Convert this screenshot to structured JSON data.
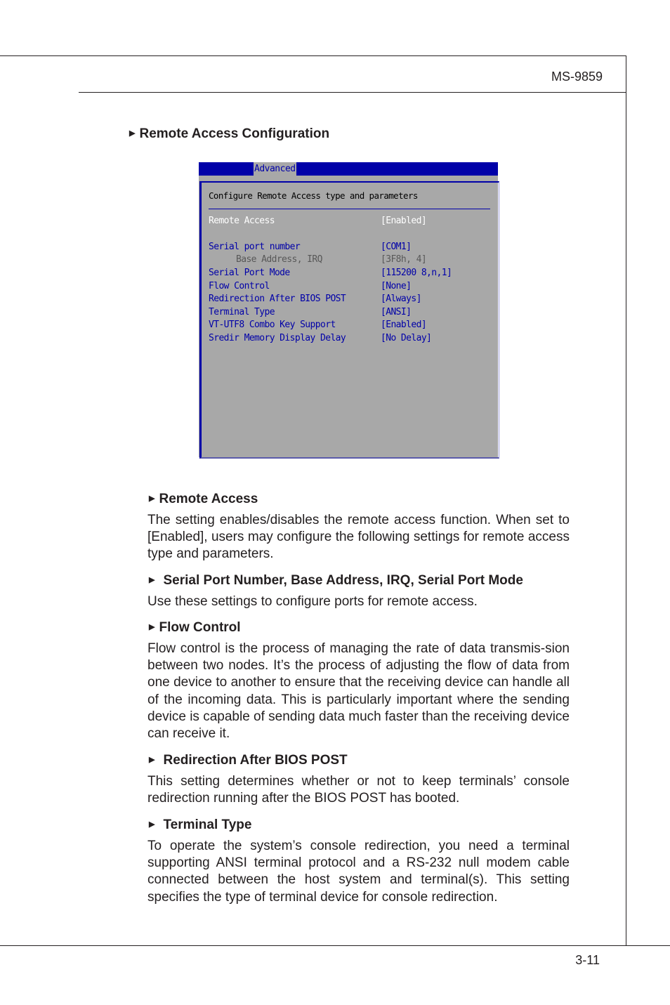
{
  "header": {
    "model": "MS-9859"
  },
  "footer": {
    "page_number": "3-11"
  },
  "section": {
    "title": "Remote Access Configuration",
    "bullet_icon": "triangle-right"
  },
  "bios": {
    "active_tab": "Advanced",
    "help_title": "Configure Remote Access type and parameters",
    "colors": {
      "background": "#a8a8a8",
      "accent": "#0000a8",
      "selected_text": "#ffffff",
      "dim_text": "#585858"
    },
    "rows": [
      {
        "label": "Remote Access",
        "value": "[Enabled]",
        "state": "selected"
      },
      {
        "label": "Serial port number",
        "value": "[COM1]",
        "state": "normal"
      },
      {
        "label": "Base Address, IRQ",
        "value": "[3F8h, 4]",
        "state": "dim"
      },
      {
        "label": "Serial Port Mode",
        "value": "[115200 8,n,1]",
        "state": "normal"
      },
      {
        "label": "Flow Control",
        "value": "[None]",
        "state": "normal"
      },
      {
        "label": "Redirection After BIOS POST",
        "value": "[Always]",
        "state": "normal"
      },
      {
        "label": "Terminal Type",
        "value": "[ANSI]",
        "state": "normal"
      },
      {
        "label": "VT-UTF8 Combo Key Support",
        "value": "[Enabled]",
        "state": "normal"
      },
      {
        "label": "Sredir Memory Display Delay",
        "value": "[No Delay]",
        "state": "normal"
      }
    ]
  },
  "descriptions": [
    {
      "title": "Remote Access",
      "body": "The setting enables/disables the remote access function. When set to [Enabled], users may configure the following settings for remote access type and parameters."
    },
    {
      "title": "Serial Port Number, Base Address, IRQ, Serial Port Mode",
      "body": "Use these settings to configure ports for remote access."
    },
    {
      "title": "Flow Control",
      "body": "Flow control is the process of managing the rate of data transmis-sion between two nodes. It’s the process of adjusting the flow of data from one device to another to ensure that the receiving device can handle all of the incoming data. This is particularly important where the sending device is capable of sending data much faster than the receiving device can receive it."
    },
    {
      "title": "Redirection After BIOS POST",
      "body": "This setting determines whether or not to keep terminals’ console redirection running after the BIOS POST has booted."
    },
    {
      "title": "Terminal Type",
      "body": "To operate the system’s console redirection, you need a terminal supporting ANSI terminal protocol and a RS-232 null modem cable connected between the host system and terminal(s). This setting specifies the type of terminal device for console redirection."
    }
  ]
}
